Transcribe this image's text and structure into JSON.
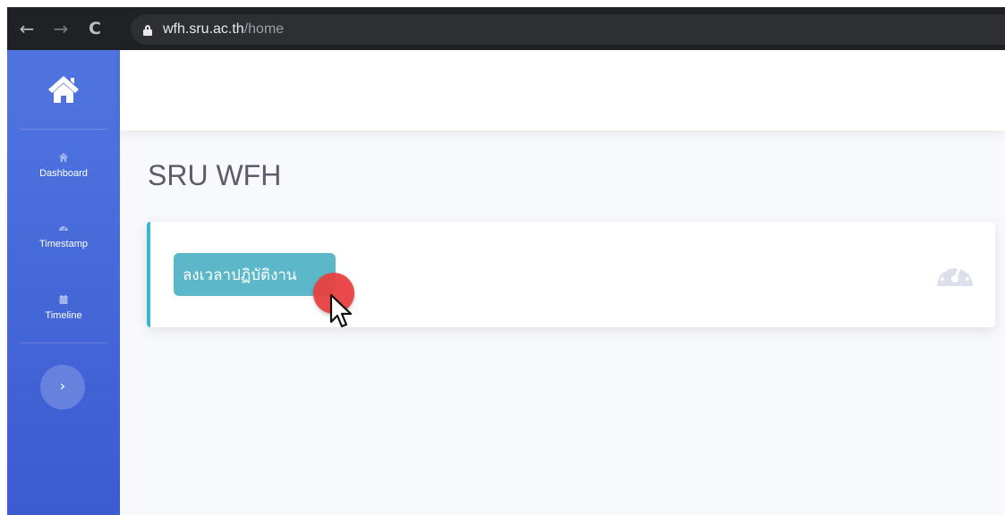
{
  "browser": {
    "url_host": "wfh.sru.ac.th",
    "url_path": "/home"
  },
  "sidebar": {
    "brand_icon": "home-icon",
    "items": [
      {
        "label": "Dashboard",
        "icon": "home-icon"
      },
      {
        "label": "Timestamp",
        "icon": "gauge-icon"
      },
      {
        "label": "Timeline",
        "icon": "calendar-icon"
      }
    ],
    "toggle_icon": "chevron-right-icon"
  },
  "main": {
    "title": "SRU WFH",
    "card": {
      "button_label": "ลงเวลาปฏิบัติงาน",
      "icon": "tachometer-icon"
    }
  },
  "colors": {
    "sidebar": "#4e73df",
    "accent": "#36b9cc",
    "button": "#5cb8c8",
    "cursor_highlight": "#e8403f"
  }
}
